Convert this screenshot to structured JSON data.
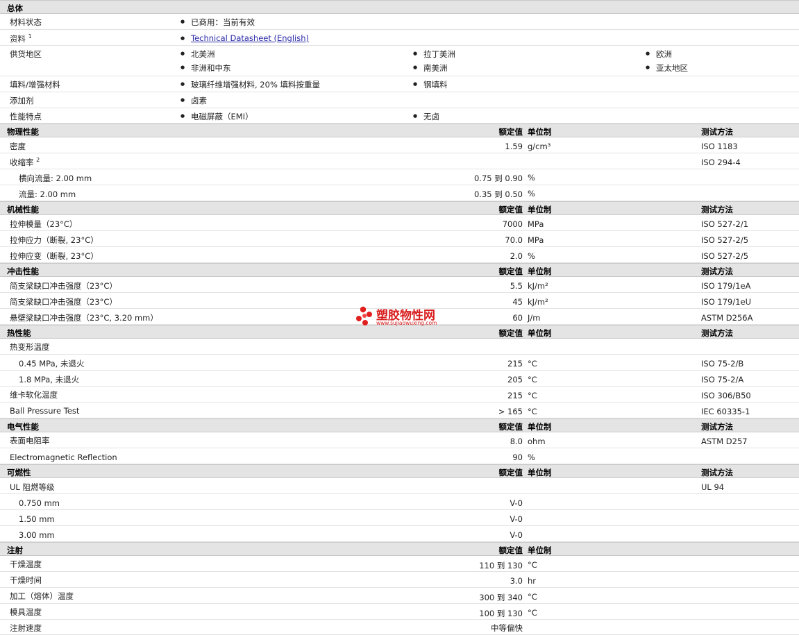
{
  "sections": {
    "general": {
      "title": "总体",
      "material_status": {
        "label": "材料状态",
        "value": "已商用：当前有效"
      },
      "resources": {
        "label": "资料",
        "sup": "1",
        "link": "Technical Datasheet (English)"
      },
      "regions": {
        "label": "供货地区",
        "items": [
          "北美洲",
          "拉丁美洲",
          "欧洲",
          "非洲和中东",
          "南美洲",
          "亚太地区"
        ]
      },
      "filler": {
        "label": "填料/增强材料",
        "items": [
          "玻璃纤维增强材料, 20% 填料按重量",
          "钢填料"
        ]
      },
      "additive": {
        "label": "添加剂",
        "items": [
          "卤素"
        ]
      },
      "features": {
        "label": "性能特点",
        "items": [
          "电磁屏蔽（EMI）",
          "无卤"
        ]
      }
    },
    "physical": {
      "title": "物理性能",
      "h_value": "额定值",
      "h_unit": "单位制",
      "h_method": "测试方法",
      "rows": [
        {
          "name": "密度",
          "value": "1.59",
          "unit": "g/cm³",
          "method": "ISO 1183"
        },
        {
          "name": "收缩率",
          "sup": "2",
          "value": "",
          "unit": "",
          "method": "ISO 294-4"
        },
        {
          "name": "横向流量: 2.00 mm",
          "value": "0.75 到  0.90",
          "unit": "%",
          "method": ""
        },
        {
          "name": "流量: 2.00 mm",
          "value": "0.35 到  0.50",
          "unit": "%",
          "method": ""
        }
      ]
    },
    "mechanical": {
      "title": "机械性能",
      "h_value": "额定值",
      "h_unit": "单位制",
      "h_method": "测试方法",
      "rows": [
        {
          "name": "拉伸模量（23°C）",
          "value": "7000",
          "unit": "MPa",
          "method": "ISO 527-2/1"
        },
        {
          "name": "拉伸应力（断裂, 23°C）",
          "value": "70.0",
          "unit": "MPa",
          "method": "ISO 527-2/5"
        },
        {
          "name": "拉伸应变（断裂, 23°C）",
          "value": "2.0",
          "unit": "%",
          "method": "ISO 527-2/5"
        }
      ]
    },
    "impact": {
      "title": "冲击性能",
      "h_value": "额定值",
      "h_unit": "单位制",
      "h_method": "测试方法",
      "rows": [
        {
          "name": "简支梁缺口冲击强度（23°C）",
          "value": "5.5",
          "unit": "kJ/m²",
          "method": "ISO 179/1eA"
        },
        {
          "name": "简支梁缺口冲击强度（23°C）",
          "value": "45",
          "unit": "kJ/m²",
          "method": "ISO 179/1eU"
        },
        {
          "name": "悬壁梁缺口冲击强度（23°C, 3.20 mm）",
          "value": "60",
          "unit": "J/m",
          "method": "ASTM D256A"
        }
      ]
    },
    "thermal": {
      "title": "热性能",
      "h_value": "额定值",
      "h_unit": "单位制",
      "h_method": "测试方法",
      "rows": [
        {
          "name": "热变形温度",
          "value": "",
          "unit": "",
          "method": ""
        },
        {
          "name": "0.45 MPa, 未退火",
          "value": "215",
          "unit": "°C",
          "method": "ISO 75-2/B"
        },
        {
          "name": "1.8 MPa, 未退火",
          "value": "205",
          "unit": "°C",
          "method": "ISO 75-2/A"
        },
        {
          "name": "维卡软化温度",
          "value": "215",
          "unit": "°C",
          "method": "ISO 306/B50"
        },
        {
          "name": "Ball Pressure Test",
          "value": "> 165",
          "unit": "°C",
          "method": "IEC 60335-1"
        }
      ]
    },
    "electrical": {
      "title": "电气性能",
      "h_value": "额定值",
      "h_unit": "单位制",
      "h_method": "测试方法",
      "rows": [
        {
          "name": "表面电阻率",
          "value": "8.0",
          "unit": "ohm",
          "method": "ASTM D257"
        },
        {
          "name": "Electromagnetic Reflection",
          "value": "90",
          "unit": "%",
          "method": ""
        }
      ]
    },
    "flammability": {
      "title": "可燃性",
      "h_value": "额定值",
      "h_unit": "单位制",
      "h_method": "测试方法",
      "rows": [
        {
          "name": "UL 阻燃等级",
          "value": "",
          "unit": "",
          "method": "UL 94"
        },
        {
          "name": "0.750 mm",
          "value": "V-0",
          "unit": "",
          "method": ""
        },
        {
          "name": "1.50 mm",
          "value": "V-0",
          "unit": "",
          "method": ""
        },
        {
          "name": "3.00 mm",
          "value": "V-0",
          "unit": "",
          "method": ""
        }
      ]
    },
    "injection": {
      "title": "注射",
      "h_value": "额定值",
      "h_unit": "单位制",
      "rows": [
        {
          "name": "干燥温度",
          "value": "110 到  130",
          "unit": "°C"
        },
        {
          "name": "干燥时间",
          "value": "3.0",
          "unit": "hr"
        },
        {
          "name": "加工（熔体）温度",
          "value": "300 到  340",
          "unit": "°C"
        },
        {
          "name": "模具温度",
          "value": "100 到  130",
          "unit": "°C"
        },
        {
          "name": "注射速度",
          "value": "中等偏快",
          "unit": ""
        }
      ]
    }
  },
  "watermark": {
    "name": "塑胶物性网",
    "url": "www.sujiaowuxing.com",
    "color": "#d81d1d"
  }
}
